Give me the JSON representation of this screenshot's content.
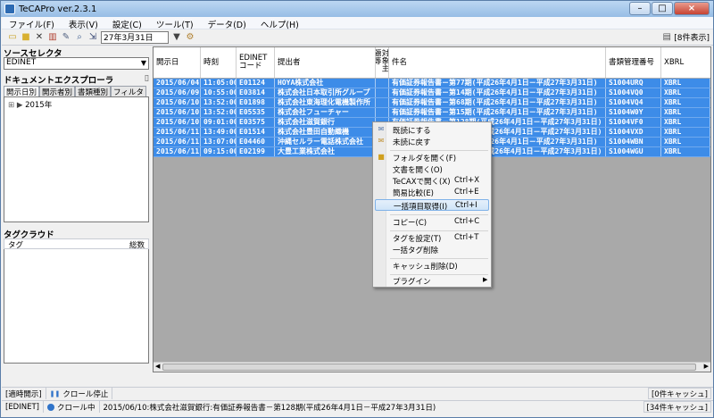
{
  "window": {
    "title": "TeCAPro ver.2.3.1"
  },
  "menu": [
    "ファイル(F)",
    "表示(V)",
    "設定(C)",
    "ツール(T)",
    "データ(D)",
    "ヘルプ(H)"
  ],
  "toolbar": {
    "date_value": "27年3月31日",
    "item_count": "[8件表示]"
  },
  "left": {
    "source_title": "ソースセレクタ",
    "source_value": "EDINET",
    "explorer_title": "ドキュメントエクスプローラ",
    "tabs": [
      "開示日別",
      "開示者別",
      "書類種別",
      "フィルタ"
    ],
    "tree_year": "2015年",
    "tag_title": "タグクラウド",
    "tag_col1": "タグ",
    "tag_col2": "総数"
  },
  "grid": {
    "columns": [
      "開示日",
      "時刻",
      "EDINETコード",
      "提出者",
      "対象主題等",
      "件名",
      "書類管理番号",
      "XBRL"
    ],
    "rows": [
      [
        "2015/06/04",
        "11:05:00",
        "E01124",
        "HOYA株式会社",
        "有価証券報告書－第77期(平成26年4月1日－平成27年3月31日)",
        "S1004URQ",
        "XBRL"
      ],
      [
        "2015/06/09",
        "10:55:00",
        "E03814",
        "株式会社日本取引所グループ",
        "有価証券報告書－第14期(平成26年4月1日－平成27年3月31日)",
        "S1004VQ0",
        "XBRL"
      ],
      [
        "2015/06/10",
        "13:52:00",
        "E01898",
        "株式会社東海理化電機製作所",
        "有価証券報告書－第68期(平成26年4月1日－平成27年3月31日)",
        "S1004VQ4",
        "XBRL"
      ],
      [
        "2015/06/10",
        "13:52:00",
        "E05535",
        "株式会社フューチャー",
        "有価証券報告書－第15期(平成26年4月1日－平成27年3月31日)",
        "S1004W0Y",
        "XBRL"
      ],
      [
        "2015/06/10",
        "09:01:00",
        "E03575",
        "株式会社滋賀銀行",
        "有価証券報告書－第128期(平成26年4月1日－平成27年3月31日)",
        "S1004VF0",
        "XBRL"
      ],
      [
        "2015/06/11",
        "13:49:00",
        "E01514",
        "株式会社豊田自動織機",
        "有価証券報告書－第137期(平成26年4月1日－平成27年3月31日)",
        "S1004VXD",
        "XBRL"
      ],
      [
        "2015/06/11",
        "13:07:00",
        "E04460",
        "沖縄セルラー電話株式会社",
        "有価証券報告書－第24期(平成26年4月1日－平成27年3月31日)",
        "S1004WBN",
        "XBRL"
      ],
      [
        "2015/06/11",
        "09:15:00",
        "E02199",
        "大豊工業株式会社",
        "有価証券報告書－第102期(平成26年4月1日－平成27年3月31日)",
        "S1004WGU",
        "XBRL"
      ]
    ]
  },
  "context_menu": {
    "mark_read": "既読にする",
    "mark_unread": "未読に戻す",
    "open_folder": "フォルダを開く(F)",
    "open_document": "文書を開く(O)",
    "open_tecax": "TeCAXで開く(X)",
    "open_tecax_key": "Ctrl+X",
    "simple_compare": "簡易比較(E)",
    "simple_compare_key": "Ctrl+E",
    "batch_fetch": "一括項目取得(I)",
    "batch_fetch_key": "Ctrl+I",
    "copy": "コピー(C)",
    "copy_key": "Ctrl+C",
    "set_tag": "タグを設定(T)",
    "set_tag_key": "Ctrl+T",
    "delete_tags": "一括タグ削除",
    "delete_cache": "キャッシュ削除(D)",
    "plugins": "プラグイン"
  },
  "status": {
    "realtime": "[適時開示]",
    "crawl_stop": "クロール停止",
    "cache1": "[0件キャッシュ]",
    "edinet": "[EDINET]",
    "crawling": "クロール中",
    "message": "2015/06/10:株式会社滋賀銀行:有価証券報告書－第128期(平成26年4月1日－平成27年3月31日)",
    "cache2": "[34件キャッシュ]"
  }
}
